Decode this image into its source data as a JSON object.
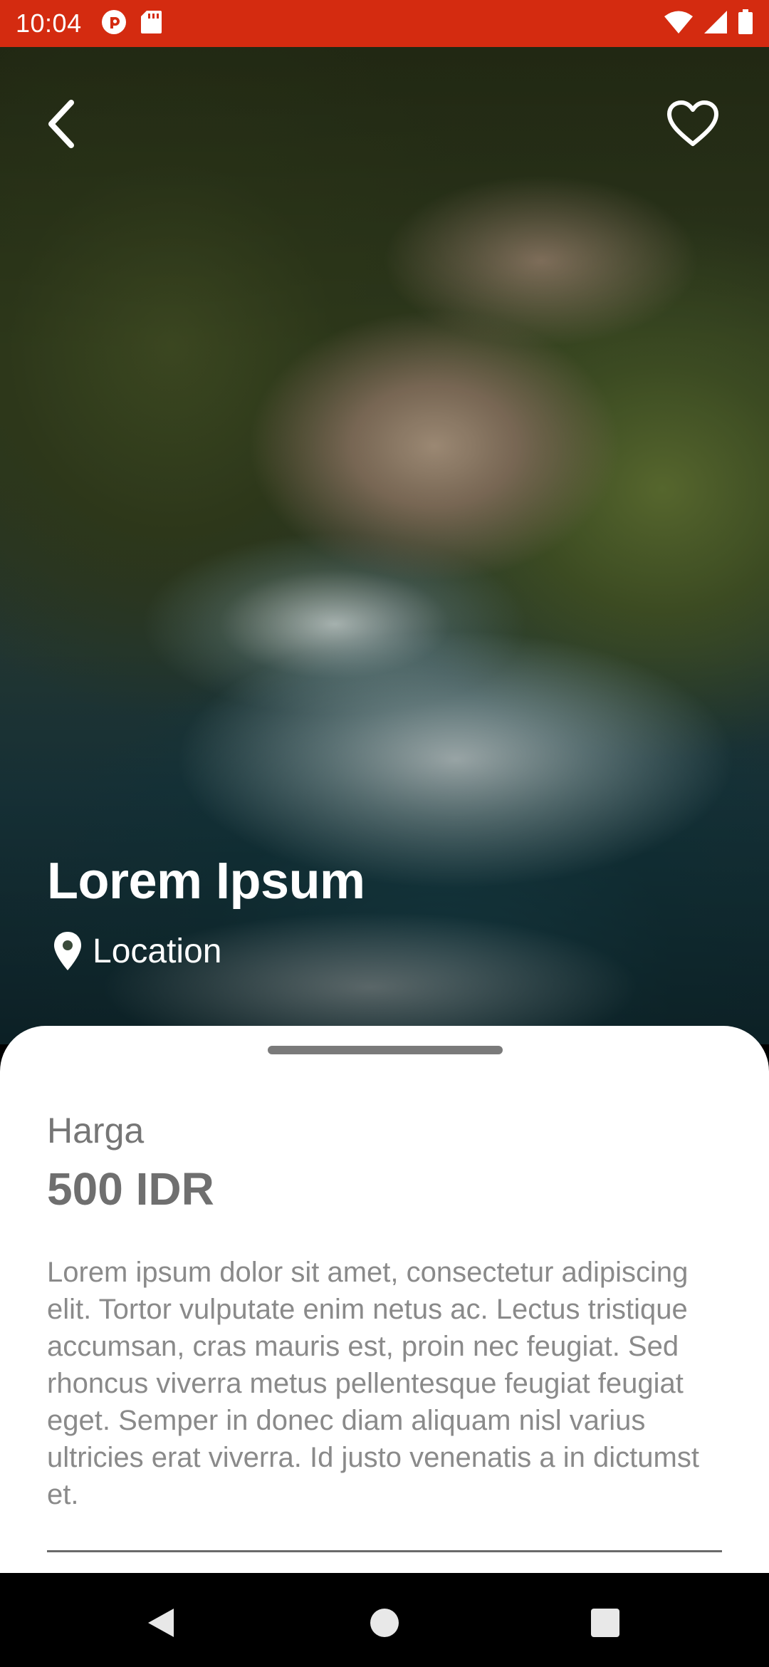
{
  "status_bar": {
    "time": "10:04",
    "icons": [
      "record-icon",
      "sd-card-icon",
      "wifi-icon",
      "cellular-signal-icon",
      "battery-icon"
    ]
  },
  "header": {
    "back_icon": "chevron-left-icon",
    "favorite_icon": "heart-outline-icon"
  },
  "place": {
    "title": "Lorem Ipsum",
    "location": "Location"
  },
  "details": {
    "price_label": "Harga",
    "price_value": "500 IDR",
    "description": "Lorem ipsum dolor sit amet, consectetur adipiscing elit. Tortor vulputate enim netus ac. Lectus tristique accumsan, cras mauris est, proin nec feugiat. Sed rhoncus viverra metus pellentesque feugiat feugiat eget. Semper in donec diam aliquam nisl varius ultricies erat viverra. Id justo venenatis a in dictumst et."
  },
  "nav_bar": {
    "icons": [
      "nav-back-icon",
      "nav-home-icon",
      "nav-recents-icon"
    ]
  },
  "colors": {
    "status_bar": "#d42b10",
    "sheet": "#ffffff",
    "text_muted": "#8a8a8a"
  }
}
